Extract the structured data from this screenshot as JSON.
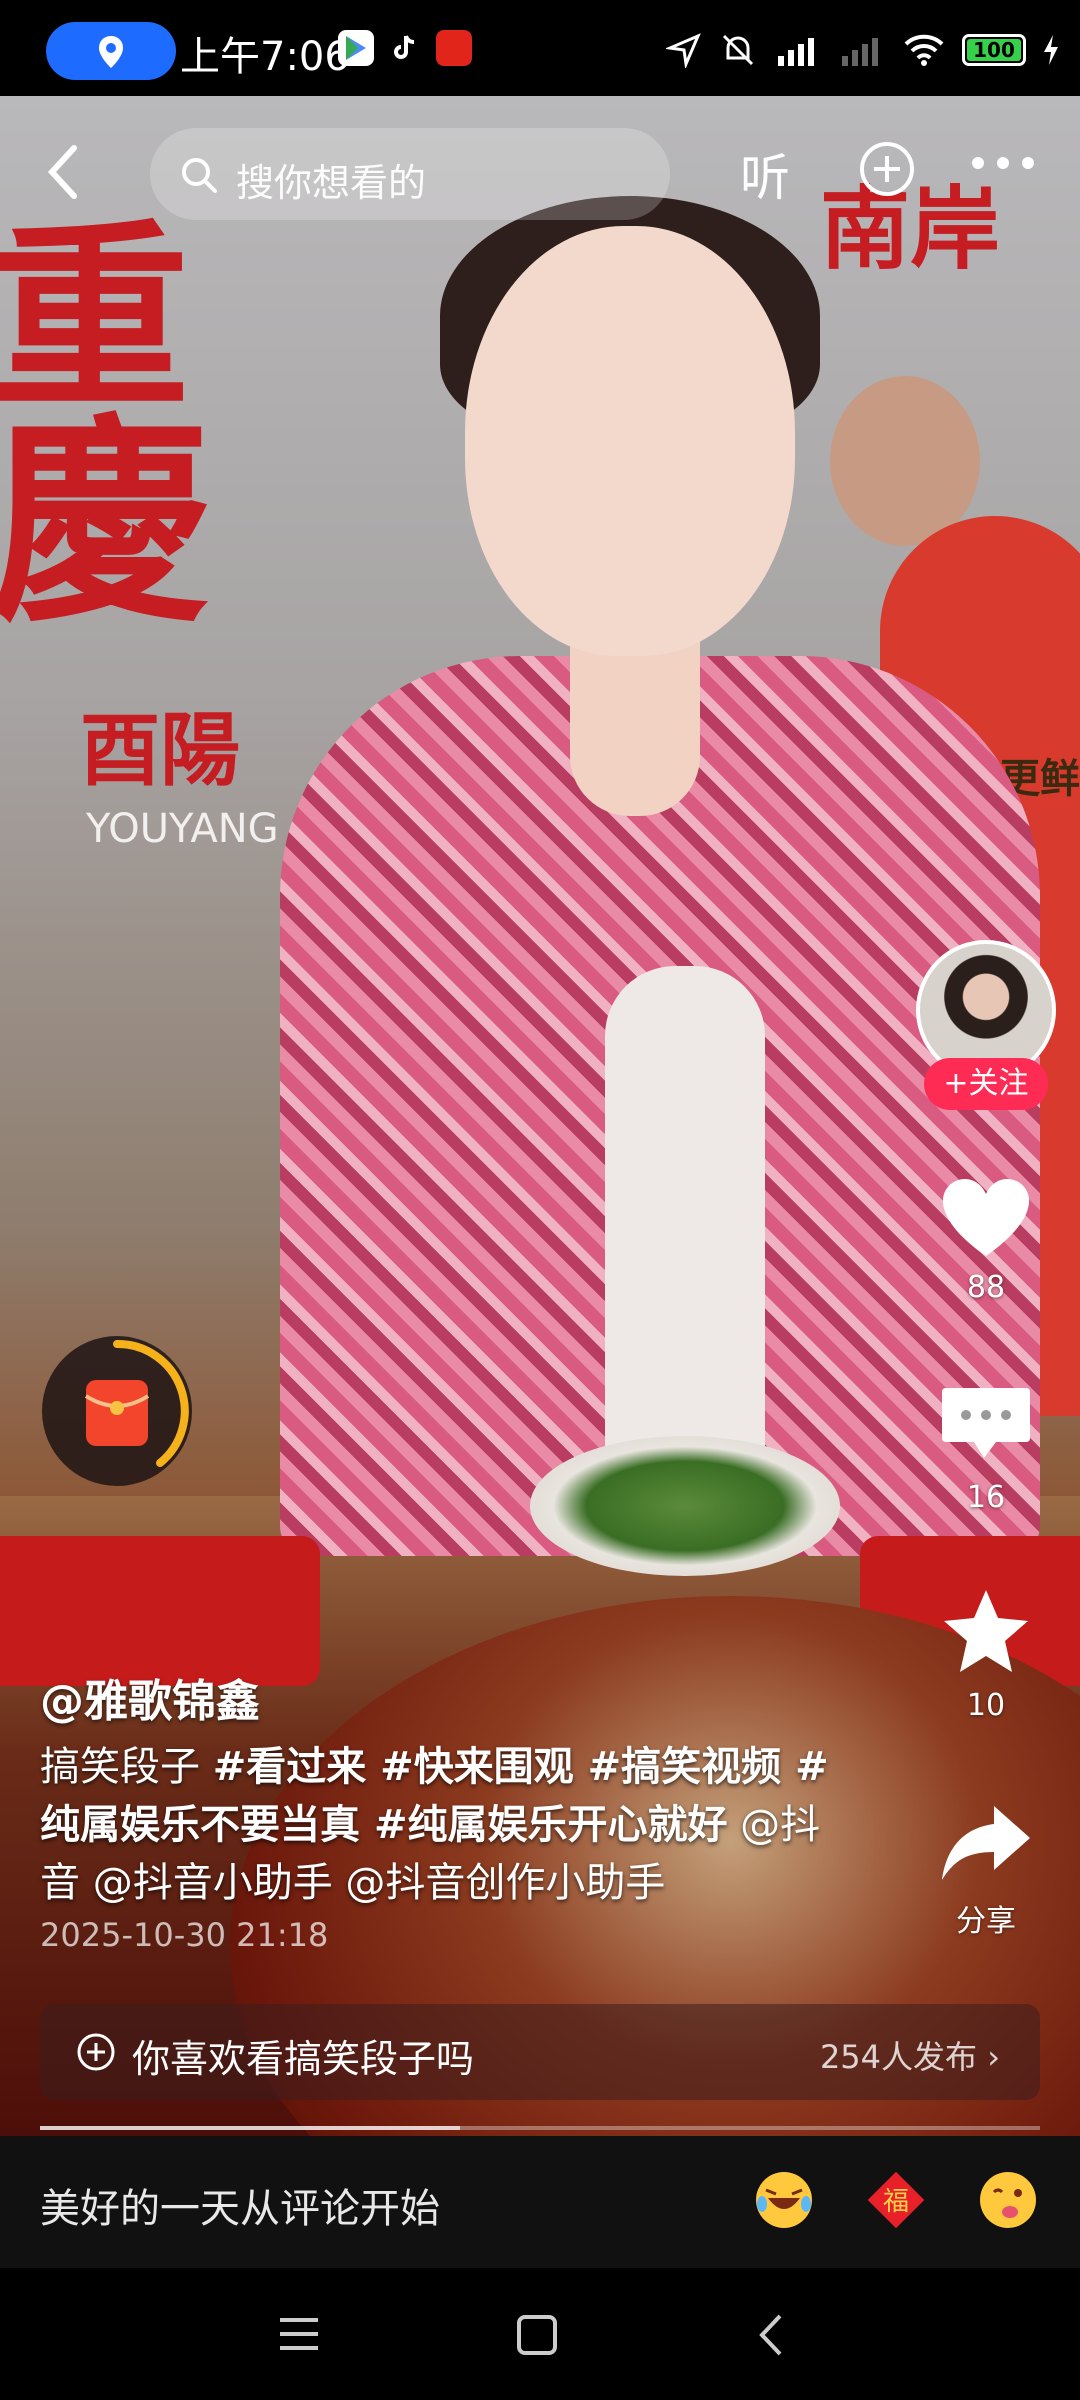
{
  "status_bar": {
    "time": "上午7:06",
    "battery": "100",
    "battery_level": 1.0
  },
  "top_bar": {
    "search_placeholder": "搜你想看的",
    "listen_label": "听"
  },
  "actions": {
    "follow_label": "+关注",
    "like_count": "88",
    "comment_count": "16",
    "favorite_count": "10",
    "share_label": "分享"
  },
  "post": {
    "author": "@雅歌锦鑫",
    "caption_plain": "搞笑段子 ",
    "tags": [
      "#看过来 ",
      "#快来围观 ",
      "#搞笑视频 ",
      "#纯属娱乐不要当真 ",
      "#纯属娱乐开心就好"
    ],
    "mentions": " @抖音 @抖音小助手 @抖音创作小助手",
    "date": "2025-10-30 21:18"
  },
  "topic": {
    "text": "你喜欢看搞笑段子吗",
    "count": "254人发布"
  },
  "video_progress": 0.42,
  "comment_bar": {
    "placeholder": "美好的一天从评论开始",
    "emojis": [
      "laughing-tears-emoji",
      "fu-emoji",
      "wink-tongue-emoji"
    ]
  },
  "scene_text": {
    "wall_1": "重",
    "wall_2": "慶",
    "wall_3": "酉陽",
    "wall_4": "YOUYANG",
    "wall_5": "南岸",
    "wall_6": "更鲜"
  },
  "colors": {
    "accent": "#fe2c55",
    "location_pill": "#1e6bff",
    "battery_fill": "#35d14b"
  }
}
